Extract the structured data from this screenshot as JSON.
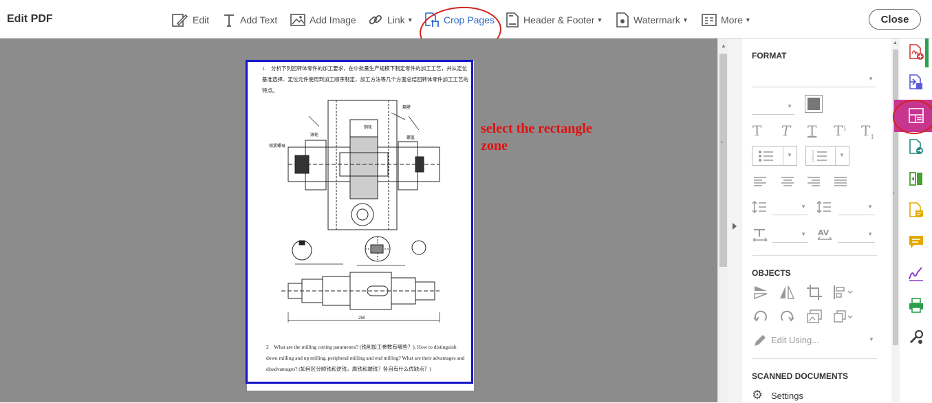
{
  "toolbar": {
    "title": "Edit PDF",
    "edit": "Edit",
    "add_text": "Add Text",
    "add_image": "Add Image",
    "link": "Link",
    "crop_pages": "Crop Pages",
    "header_footer": "Header & Footer",
    "watermark": "Watermark",
    "more": "More",
    "close": "Close"
  },
  "document": {
    "para1_line1": "1.　分析下列回转体零件的加工要求，在中批量生产规模下制定零件的加工工艺，并从定位",
    "para1_line2": "基准选择、定位元件使用到加工顺序制定，加工方法等几个方面总结回转体零件加工工艺的",
    "para1_line3": "特点。",
    "para2_line1": "2　What are the milling cutting parameters? (铣削加工参数有哪些？), How to distinguish",
    "para2_line2": "down milling and up milling, peripheral milling and end milling? What are their advantages and",
    "para2_line3": "disadvantages? (如何区分顺铣和逆铣，周铣和端铣？各自有什么优缺点？)"
  },
  "annotation": {
    "line1": "select the rectangle",
    "line2": "zone"
  },
  "panel": {
    "format_title": "FORMAT",
    "objects_title": "OBJECTS",
    "edit_using": "Edit Using...",
    "scanned_title": "SCANNED DOCUMENTS",
    "settings": "Settings"
  },
  "colors": {
    "accent_blue": "#2a68c7",
    "annotation_red": "#e01010",
    "crop_border": "#1515c8",
    "active_rail": "#c8358f"
  }
}
